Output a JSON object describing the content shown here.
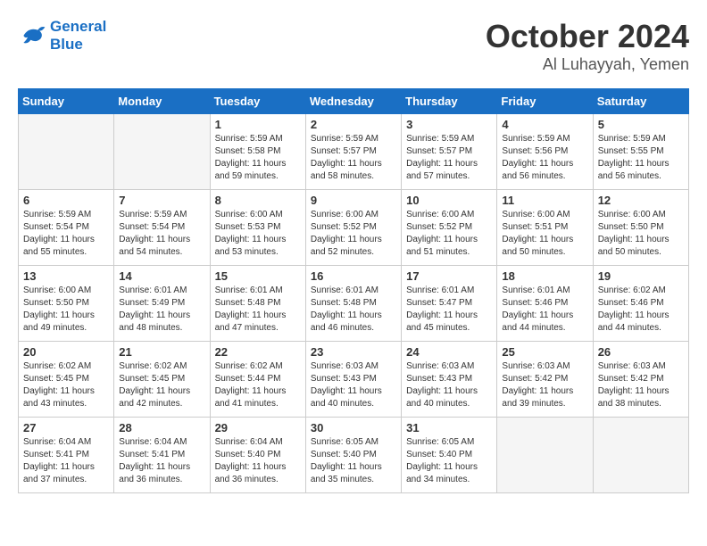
{
  "header": {
    "logo_line1": "General",
    "logo_line2": "Blue",
    "month": "October 2024",
    "location": "Al Luhayyah, Yemen"
  },
  "weekdays": [
    "Sunday",
    "Monday",
    "Tuesday",
    "Wednesday",
    "Thursday",
    "Friday",
    "Saturday"
  ],
  "weeks": [
    [
      {
        "day": "",
        "info": ""
      },
      {
        "day": "",
        "info": ""
      },
      {
        "day": "1",
        "info": "Sunrise: 5:59 AM\nSunset: 5:58 PM\nDaylight: 11 hours and 59 minutes."
      },
      {
        "day": "2",
        "info": "Sunrise: 5:59 AM\nSunset: 5:57 PM\nDaylight: 11 hours and 58 minutes."
      },
      {
        "day": "3",
        "info": "Sunrise: 5:59 AM\nSunset: 5:57 PM\nDaylight: 11 hours and 57 minutes."
      },
      {
        "day": "4",
        "info": "Sunrise: 5:59 AM\nSunset: 5:56 PM\nDaylight: 11 hours and 56 minutes."
      },
      {
        "day": "5",
        "info": "Sunrise: 5:59 AM\nSunset: 5:55 PM\nDaylight: 11 hours and 56 minutes."
      }
    ],
    [
      {
        "day": "6",
        "info": "Sunrise: 5:59 AM\nSunset: 5:54 PM\nDaylight: 11 hours and 55 minutes."
      },
      {
        "day": "7",
        "info": "Sunrise: 5:59 AM\nSunset: 5:54 PM\nDaylight: 11 hours and 54 minutes."
      },
      {
        "day": "8",
        "info": "Sunrise: 6:00 AM\nSunset: 5:53 PM\nDaylight: 11 hours and 53 minutes."
      },
      {
        "day": "9",
        "info": "Sunrise: 6:00 AM\nSunset: 5:52 PM\nDaylight: 11 hours and 52 minutes."
      },
      {
        "day": "10",
        "info": "Sunrise: 6:00 AM\nSunset: 5:52 PM\nDaylight: 11 hours and 51 minutes."
      },
      {
        "day": "11",
        "info": "Sunrise: 6:00 AM\nSunset: 5:51 PM\nDaylight: 11 hours and 50 minutes."
      },
      {
        "day": "12",
        "info": "Sunrise: 6:00 AM\nSunset: 5:50 PM\nDaylight: 11 hours and 50 minutes."
      }
    ],
    [
      {
        "day": "13",
        "info": "Sunrise: 6:00 AM\nSunset: 5:50 PM\nDaylight: 11 hours and 49 minutes."
      },
      {
        "day": "14",
        "info": "Sunrise: 6:01 AM\nSunset: 5:49 PM\nDaylight: 11 hours and 48 minutes."
      },
      {
        "day": "15",
        "info": "Sunrise: 6:01 AM\nSunset: 5:48 PM\nDaylight: 11 hours and 47 minutes."
      },
      {
        "day": "16",
        "info": "Sunrise: 6:01 AM\nSunset: 5:48 PM\nDaylight: 11 hours and 46 minutes."
      },
      {
        "day": "17",
        "info": "Sunrise: 6:01 AM\nSunset: 5:47 PM\nDaylight: 11 hours and 45 minutes."
      },
      {
        "day": "18",
        "info": "Sunrise: 6:01 AM\nSunset: 5:46 PM\nDaylight: 11 hours and 44 minutes."
      },
      {
        "day": "19",
        "info": "Sunrise: 6:02 AM\nSunset: 5:46 PM\nDaylight: 11 hours and 44 minutes."
      }
    ],
    [
      {
        "day": "20",
        "info": "Sunrise: 6:02 AM\nSunset: 5:45 PM\nDaylight: 11 hours and 43 minutes."
      },
      {
        "day": "21",
        "info": "Sunrise: 6:02 AM\nSunset: 5:45 PM\nDaylight: 11 hours and 42 minutes."
      },
      {
        "day": "22",
        "info": "Sunrise: 6:02 AM\nSunset: 5:44 PM\nDaylight: 11 hours and 41 minutes."
      },
      {
        "day": "23",
        "info": "Sunrise: 6:03 AM\nSunset: 5:43 PM\nDaylight: 11 hours and 40 minutes."
      },
      {
        "day": "24",
        "info": "Sunrise: 6:03 AM\nSunset: 5:43 PM\nDaylight: 11 hours and 40 minutes."
      },
      {
        "day": "25",
        "info": "Sunrise: 6:03 AM\nSunset: 5:42 PM\nDaylight: 11 hours and 39 minutes."
      },
      {
        "day": "26",
        "info": "Sunrise: 6:03 AM\nSunset: 5:42 PM\nDaylight: 11 hours and 38 minutes."
      }
    ],
    [
      {
        "day": "27",
        "info": "Sunrise: 6:04 AM\nSunset: 5:41 PM\nDaylight: 11 hours and 37 minutes."
      },
      {
        "day": "28",
        "info": "Sunrise: 6:04 AM\nSunset: 5:41 PM\nDaylight: 11 hours and 36 minutes."
      },
      {
        "day": "29",
        "info": "Sunrise: 6:04 AM\nSunset: 5:40 PM\nDaylight: 11 hours and 36 minutes."
      },
      {
        "day": "30",
        "info": "Sunrise: 6:05 AM\nSunset: 5:40 PM\nDaylight: 11 hours and 35 minutes."
      },
      {
        "day": "31",
        "info": "Sunrise: 6:05 AM\nSunset: 5:40 PM\nDaylight: 11 hours and 34 minutes."
      },
      {
        "day": "",
        "info": ""
      },
      {
        "day": "",
        "info": ""
      }
    ]
  ]
}
